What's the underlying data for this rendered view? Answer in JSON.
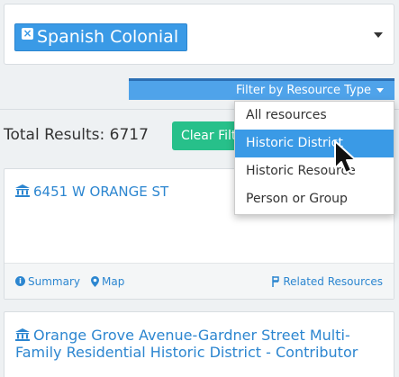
{
  "search": {
    "tag_label": "Spanish Colonial"
  },
  "filter": {
    "button_label": "Filter by Resource Type",
    "options": [
      "All resources",
      "Historic District",
      "Historic Resource",
      "Person or Group"
    ],
    "selected": "Historic District"
  },
  "results": {
    "total_label": "Total Results: 6717",
    "clear_label": "Clear Filters"
  },
  "cards": [
    {
      "title": "6451 W ORANGE ST",
      "summary_label": "Summary",
      "map_label": "Map",
      "related_label": "Related Resources"
    },
    {
      "title": "Orange Grove Avenue-Gardner Street Multi-Family Residential Historic District - Contributor"
    }
  ],
  "colors": {
    "primary": "#3a9ae6",
    "filter_bar": "#4fa3ea",
    "clear_button": "#27c08a",
    "link": "#2c86d0"
  },
  "icons": [
    "remove-tag-icon",
    "caret-down-icon",
    "bank-icon",
    "info-icon",
    "map-marker-icon",
    "related-icon",
    "mouse-pointer-icon"
  ]
}
